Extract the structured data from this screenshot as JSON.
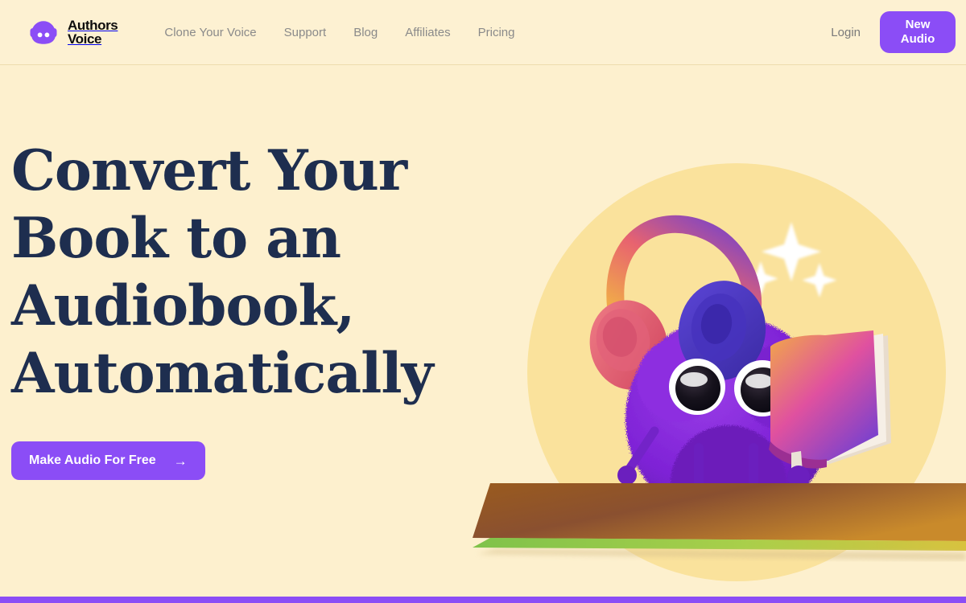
{
  "brand": {
    "icon": "headphone-blob-logo",
    "line1": "Authors",
    "line2": "Voice"
  },
  "nav": {
    "items": [
      {
        "label": "Clone Your Voice"
      },
      {
        "label": "Support"
      },
      {
        "label": "Blog"
      },
      {
        "label": "Affiliates"
      },
      {
        "label": "Pricing"
      }
    ],
    "login_label": "Login",
    "new_audio_line1": "New",
    "new_audio_line2": "Audio"
  },
  "hero": {
    "title_lines": [
      "Convert Your",
      "Book to an",
      "Audiobook,",
      "Automatically"
    ],
    "cta_label": "Make Audio For Free",
    "cta_arrow": "→",
    "illustration": "purple-fuzzy-monster-with-headphones-holding-book"
  },
  "colors": {
    "page_background": "#fdf0ce",
    "header_background": "#fdf1d2",
    "accent_purple": "#8b4df6",
    "heading_navy": "#1e2e4f",
    "nav_text": "#8a8a8a",
    "circle_backdrop": "#fae29c",
    "bottom_bar": "#8b4df6"
  }
}
